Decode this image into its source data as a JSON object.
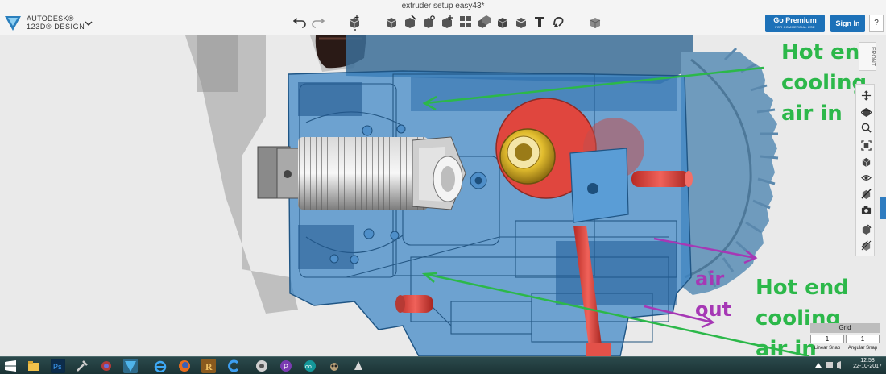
{
  "window": {
    "title": "extruder setup easy43*"
  },
  "brand": {
    "top": "AUTODESK®",
    "bottom": "123D® DESIGN"
  },
  "toolbar": {
    "tools": [
      {
        "icon": "undo-icon"
      },
      {
        "icon": "redo-icon"
      },
      {
        "icon": "add-primitive-icon"
      },
      {
        "icon": "sketch-icon"
      },
      {
        "icon": "construct-icon"
      },
      {
        "icon": "modify-icon"
      },
      {
        "icon": "pattern-icon"
      },
      {
        "icon": "group-icon"
      },
      {
        "icon": "combine-icon"
      },
      {
        "icon": "measure-icon"
      },
      {
        "icon": "text-icon"
      },
      {
        "icon": "snap-icon"
      },
      {
        "icon": "material-icon"
      }
    ]
  },
  "account": {
    "premium_label": "Go Premium",
    "premium_sub": "FOR COMMERCIAL USE",
    "signin_label": "Sign In",
    "help_label": "?"
  },
  "viewcube": {
    "label": "FRONT"
  },
  "annotations": {
    "hot_end_top_1": "Hot end",
    "hot_end_top_2": "cooling",
    "hot_end_top_3": "air in",
    "air_out_1": "air",
    "air_out_2": "out",
    "hot_end_bottom_1": "Hot end",
    "hot_end_bottom_2": "cooling",
    "hot_end_bottom_3": "air in"
  },
  "navbar": {
    "buttons": [
      {
        "icon": "pan-icon"
      },
      {
        "icon": "orbit-icon"
      },
      {
        "icon": "zoom-icon"
      },
      {
        "icon": "fit-icon"
      },
      {
        "icon": "view-cube-icon"
      },
      {
        "icon": "visibility-icon"
      },
      {
        "icon": "hide-icon"
      },
      {
        "icon": "camera-icon"
      },
      {
        "icon": "materials-icon"
      },
      {
        "icon": "outline-icon"
      }
    ]
  },
  "snap": {
    "grid_label": "Grid",
    "linear_value": "1",
    "angular_value": "1",
    "linear_label": "Linear Snap",
    "angular_label": "Angular Snap"
  },
  "taskbar": {
    "apps": [
      {
        "icon": "start-icon"
      },
      {
        "icon": "explorer-icon"
      },
      {
        "icon": "photoshop-icon"
      },
      {
        "icon": "tool-icon"
      },
      {
        "icon": "app-icon"
      },
      {
        "icon": "123d-icon"
      },
      {
        "icon": "ie-icon"
      },
      {
        "icon": "firefox-icon"
      },
      {
        "icon": "recuva-icon"
      },
      {
        "icon": "ccleaner-icon"
      },
      {
        "icon": "chrome-icon"
      },
      {
        "icon": "paint-icon"
      },
      {
        "icon": "arduino-icon"
      },
      {
        "icon": "gimp-icon"
      },
      {
        "icon": "misc-icon"
      }
    ],
    "clock": {
      "time": "12:58",
      "date": "22-10-2017"
    }
  },
  "colors": {
    "accent": "#1d71b8",
    "annotation_green": "#2cb84a",
    "annotation_purple": "#a638b5",
    "part_blue": "#3d86c6",
    "part_red": "#e0463e",
    "brass": "#d4b128"
  }
}
